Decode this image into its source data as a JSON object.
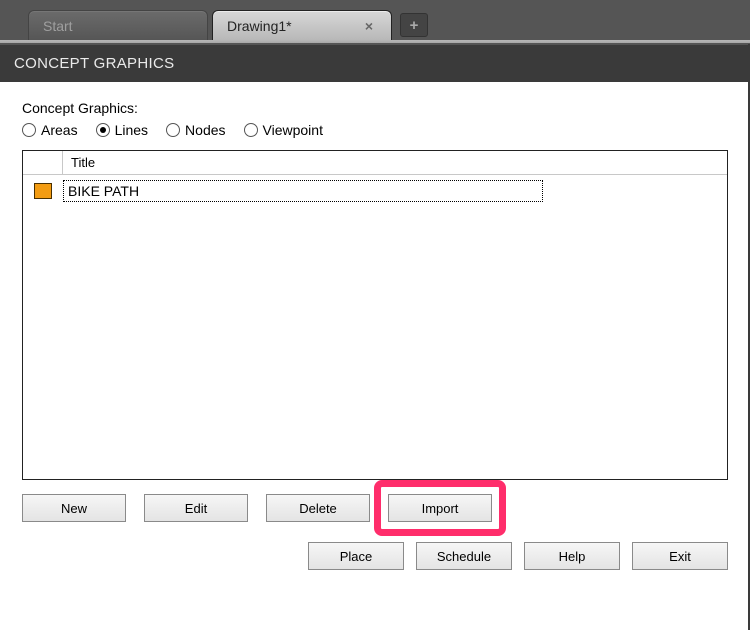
{
  "tabs": {
    "inactive_label": "Start",
    "active_label": "Drawing1*"
  },
  "panel": {
    "header": "CONCEPT GRAPHICS",
    "group_label": "Concept Graphics:"
  },
  "radios": {
    "areas": "Areas",
    "lines": "Lines",
    "nodes": "Nodes",
    "viewpoint": "Viewpoint",
    "selected": "lines"
  },
  "list": {
    "header_title": "Title",
    "rows": [
      {
        "color": "#f39c12",
        "title": "BIKE PATH"
      }
    ]
  },
  "buttons": {
    "new": "New",
    "edit": "Edit",
    "delete": "Delete",
    "import": "Import",
    "place": "Place",
    "schedule": "Schedule",
    "help": "Help",
    "exit": "Exit"
  },
  "highlight": {
    "target_button": "import",
    "color": "#ff2d6b"
  }
}
